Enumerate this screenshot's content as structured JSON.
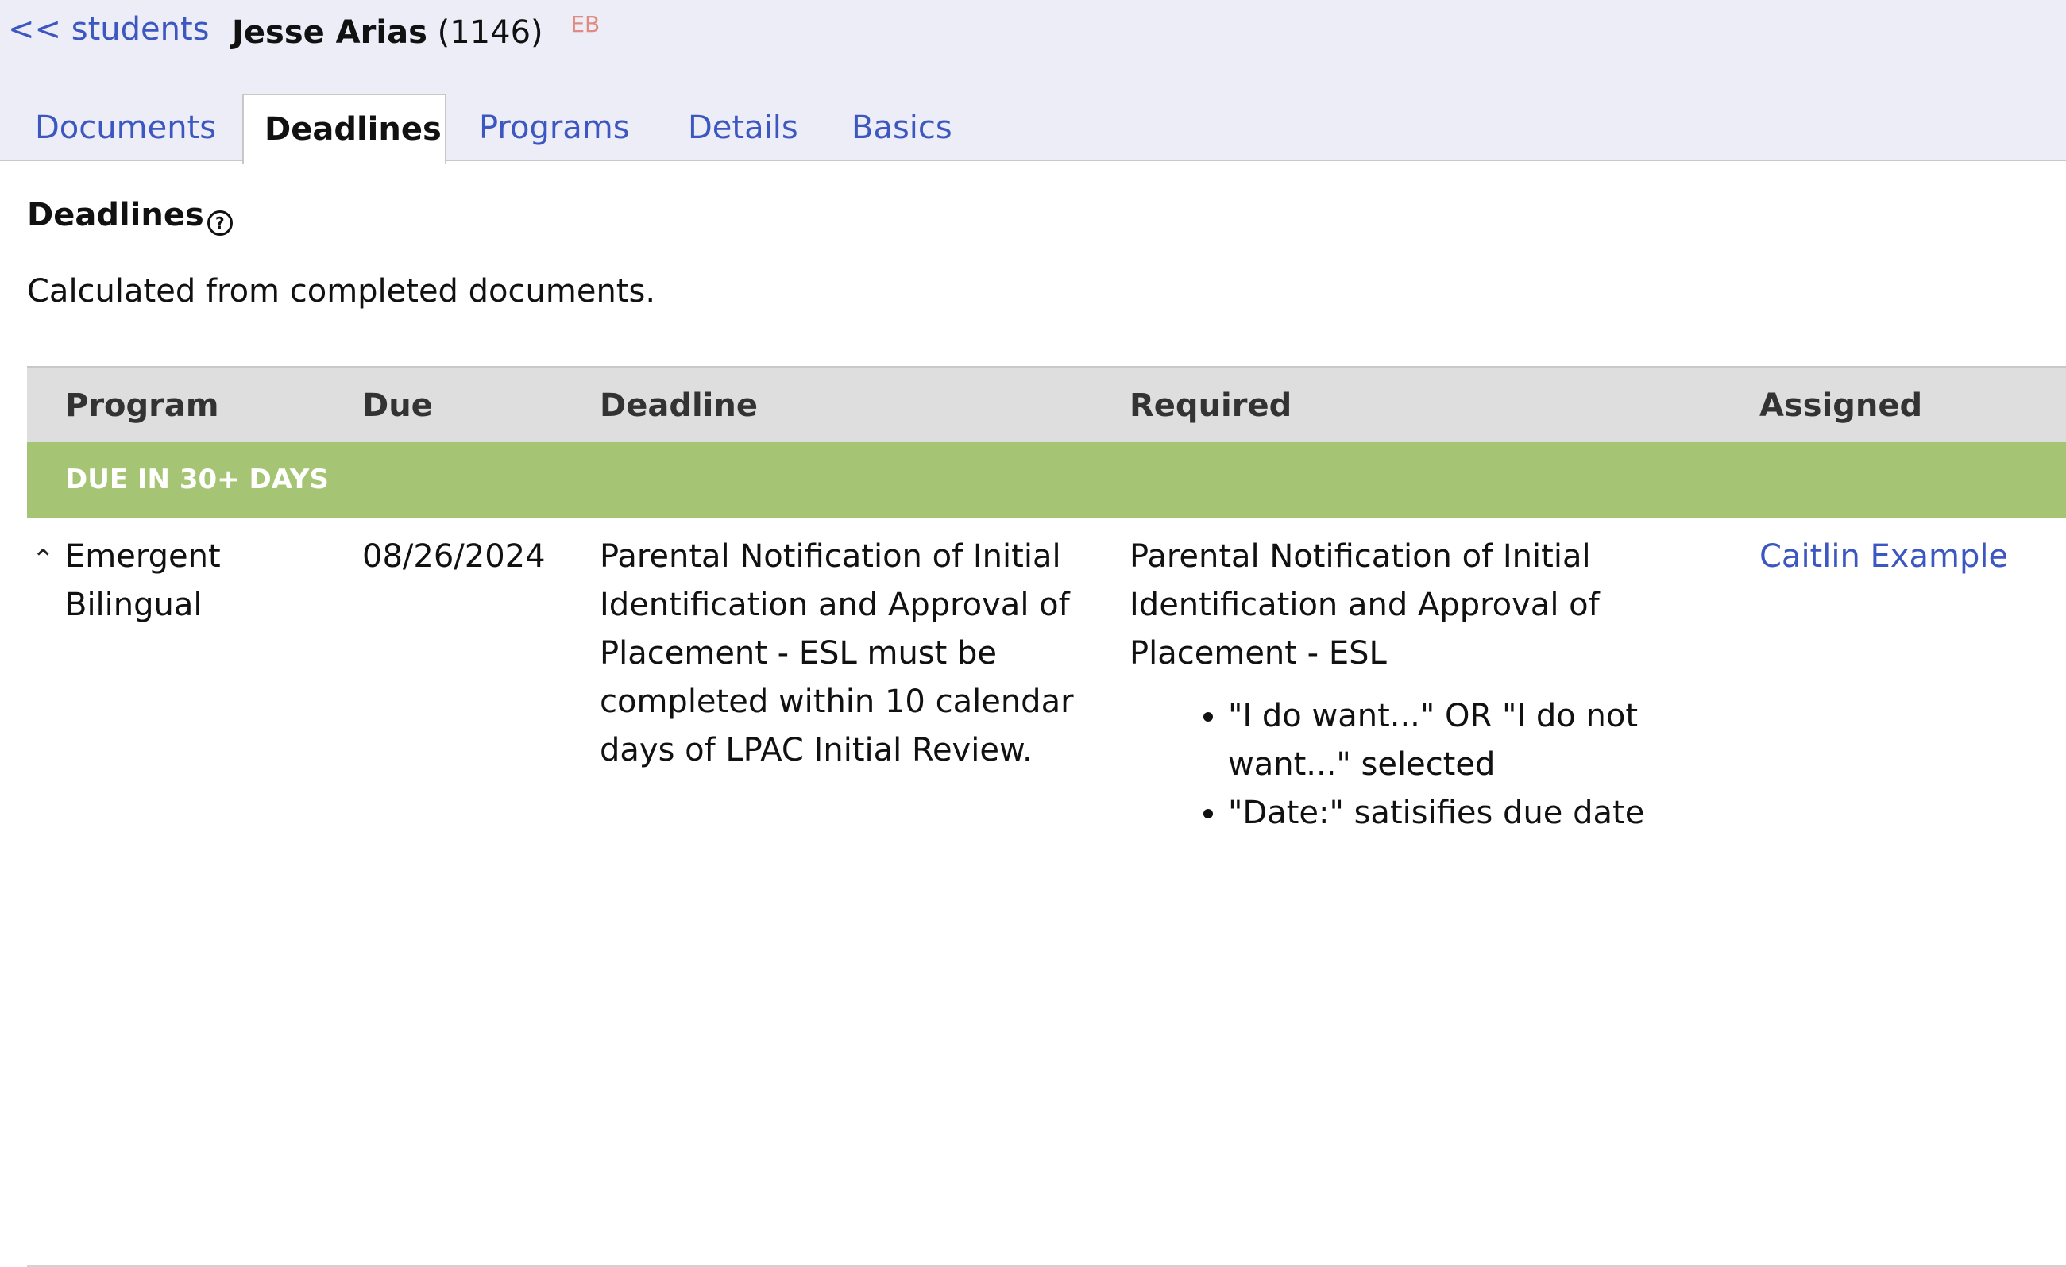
{
  "nav": {
    "back_label": "<< students"
  },
  "student": {
    "name": "Jesse Arias",
    "id": "(1146)",
    "badge": "EB"
  },
  "tabs": [
    {
      "label": "Documents",
      "active": false
    },
    {
      "label": "Deadlines",
      "active": true
    },
    {
      "label": "Programs",
      "active": false
    },
    {
      "label": "Details",
      "active": false
    },
    {
      "label": "Basics",
      "active": false
    }
  ],
  "section": {
    "heading": "Deadlines",
    "help_icon": "question-circle-icon",
    "description": "Calculated from completed documents."
  },
  "table": {
    "columns": [
      "Program",
      "Due",
      "Deadline",
      "Required",
      "Assigned"
    ],
    "groups": [
      {
        "label": "DUE IN 30+ DAYS",
        "color": "#a5c574",
        "rows": [
          {
            "program": "Emergent Bilingual",
            "expand_icon": "chevron-up-icon",
            "due": "08/26/2024",
            "deadline": "Parental Notification of Initial Identification and Approval of Placement - ESL must be completed within 10 calendar days of LPAC Initial Review.",
            "required_title": "Parental Notification of Initial Identification and Approval of Placement - ESL",
            "required_items": [
              "\"I do want...\" OR \"I do not want...\" selected",
              "\"Date:\" satisifies due date"
            ],
            "assigned": "Caitlin Example"
          }
        ]
      }
    ]
  },
  "colors": {
    "link": "#3d57c0",
    "header_bg": "#ecedf7",
    "badge": "#e08a80"
  }
}
